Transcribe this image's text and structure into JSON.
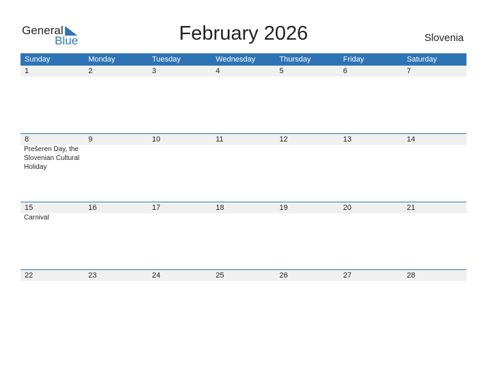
{
  "logo": {
    "general": "General",
    "blue": "Blue"
  },
  "title": "February 2026",
  "country": "Slovenia",
  "weekdays": [
    "Sunday",
    "Monday",
    "Tuesday",
    "Wednesday",
    "Thursday",
    "Friday",
    "Saturday"
  ],
  "weeks": [
    {
      "days": [
        "1",
        "2",
        "3",
        "4",
        "5",
        "6",
        "7"
      ],
      "events": [
        "",
        "",
        "",
        "",
        "",
        "",
        ""
      ]
    },
    {
      "days": [
        "8",
        "9",
        "10",
        "11",
        "12",
        "13",
        "14"
      ],
      "events": [
        "Prešeren Day, the Slovenian Cultural Holiday",
        "",
        "",
        "",
        "",
        "",
        ""
      ]
    },
    {
      "days": [
        "15",
        "16",
        "17",
        "18",
        "19",
        "20",
        "21"
      ],
      "events": [
        "Carnival",
        "",
        "",
        "",
        "",
        "",
        ""
      ]
    },
    {
      "days": [
        "22",
        "23",
        "24",
        "25",
        "26",
        "27",
        "28"
      ],
      "events": [
        "",
        "",
        "",
        "",
        "",
        "",
        ""
      ]
    }
  ],
  "colors": {
    "accent": "#2e74b5"
  }
}
